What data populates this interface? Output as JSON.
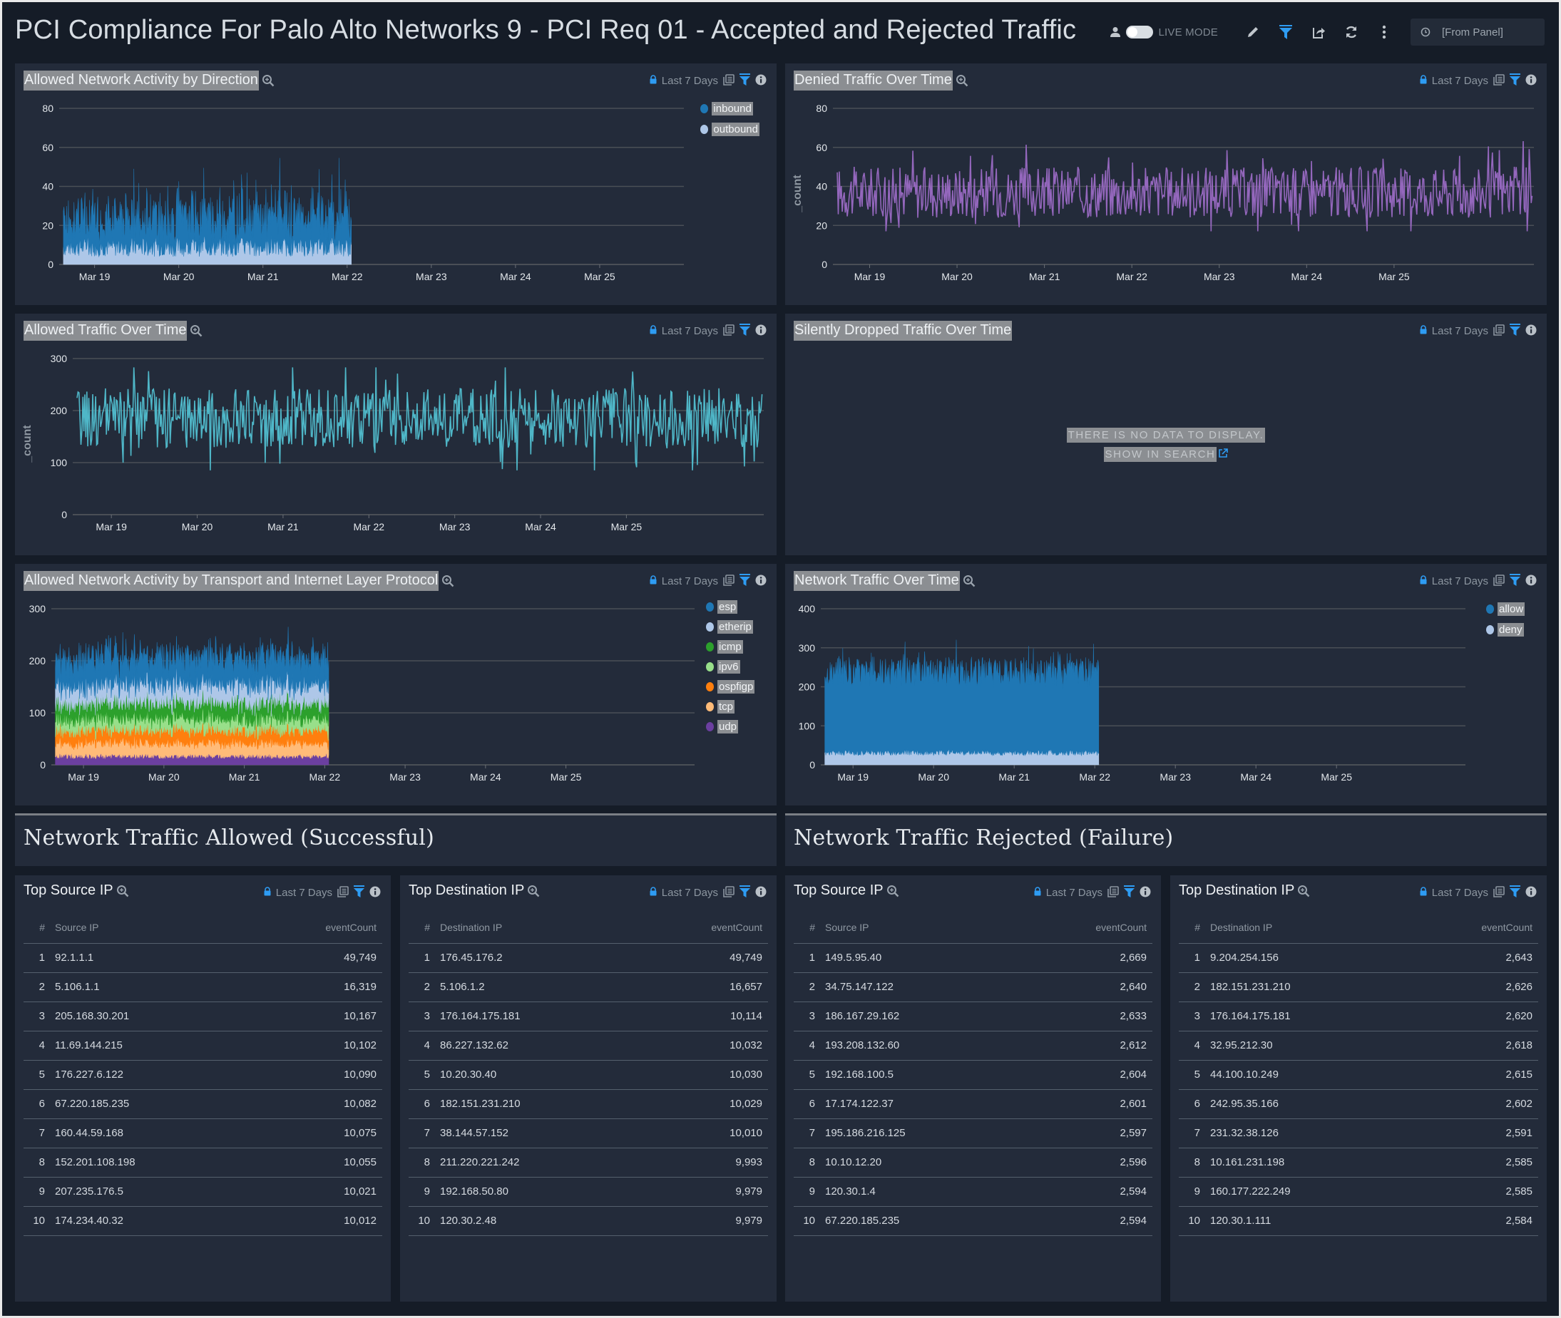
{
  "header": {
    "title": "PCI Compliance For Palo Alto Networks 9 - PCI Req 01 - Accepted and Rejected Traffic",
    "live_mode_label": "LIVE MODE",
    "time_range": "[From Panel]"
  },
  "time_badge": "Last 7 Days",
  "panels": {
    "direction": {
      "title": "Allowed Network Activity by Direction",
      "legend": [
        "inbound",
        "outbound"
      ]
    },
    "denied": {
      "title": "Denied Traffic Over Time"
    },
    "allowed": {
      "title": "Allowed Traffic Over Time"
    },
    "dropped": {
      "title": "Silently Dropped Traffic Over Time",
      "no_data": "THERE IS NO DATA TO DISPLAY.",
      "show_search": "SHOW IN SEARCH"
    },
    "protocol": {
      "title": "Allowed Network Activity by Transport and Internet Layer Protocol",
      "legend": [
        "esp",
        "etherip",
        "icmp",
        "ipv6",
        "ospfigp",
        "tcp",
        "udp"
      ]
    },
    "network": {
      "title": "Network Traffic Over Time",
      "legend": [
        "allow",
        "deny"
      ]
    }
  },
  "sections": {
    "allowed": "Network Traffic Allowed (Successful)",
    "rejected": "Network Traffic Rejected (Failure)"
  },
  "tables": [
    {
      "title": "Top Source IP",
      "col_num": "#",
      "col_ip": "Source IP",
      "col_count": "eventCount",
      "rows": [
        [
          "1",
          "92.1.1.1",
          "49,749"
        ],
        [
          "2",
          "5.106.1.1",
          "16,319"
        ],
        [
          "3",
          "205.168.30.201",
          "10,167"
        ],
        [
          "4",
          "11.69.144.215",
          "10,102"
        ],
        [
          "5",
          "176.227.6.122",
          "10,090"
        ],
        [
          "6",
          "67.220.185.235",
          "10,082"
        ],
        [
          "7",
          "160.44.59.168",
          "10,075"
        ],
        [
          "8",
          "152.201.108.198",
          "10,055"
        ],
        [
          "9",
          "207.235.176.5",
          "10,021"
        ],
        [
          "10",
          "174.234.40.32",
          "10,012"
        ]
      ]
    },
    {
      "title": "Top Destination IP",
      "col_num": "#",
      "col_ip": "Destination IP",
      "col_count": "eventCount",
      "rows": [
        [
          "1",
          "176.45.176.2",
          "49,749"
        ],
        [
          "2",
          "5.106.1.2",
          "16,657"
        ],
        [
          "3",
          "176.164.175.181",
          "10,114"
        ],
        [
          "4",
          "86.227.132.62",
          "10,032"
        ],
        [
          "5",
          "10.20.30.40",
          "10,030"
        ],
        [
          "6",
          "182.151.231.210",
          "10,029"
        ],
        [
          "7",
          "38.144.57.152",
          "10,010"
        ],
        [
          "8",
          "211.220.221.242",
          "9,993"
        ],
        [
          "9",
          "192.168.50.80",
          "9,979"
        ],
        [
          "10",
          "120.30.2.48",
          "9,979"
        ]
      ]
    },
    {
      "title": "Top Source IP",
      "col_num": "#",
      "col_ip": "Source IP",
      "col_count": "eventCount",
      "rows": [
        [
          "1",
          "149.5.95.40",
          "2,669"
        ],
        [
          "2",
          "34.75.147.122",
          "2,640"
        ],
        [
          "3",
          "186.167.29.162",
          "2,633"
        ],
        [
          "4",
          "193.208.132.60",
          "2,612"
        ],
        [
          "5",
          "192.168.100.5",
          "2,604"
        ],
        [
          "6",
          "17.174.122.37",
          "2,601"
        ],
        [
          "7",
          "195.186.216.125",
          "2,597"
        ],
        [
          "8",
          "10.10.12.20",
          "2,596"
        ],
        [
          "9",
          "120.30.1.4",
          "2,594"
        ],
        [
          "10",
          "67.220.185.235",
          "2,594"
        ]
      ]
    },
    {
      "title": "Top Destination IP",
      "col_num": "#",
      "col_ip": "Destination IP",
      "col_count": "eventCount",
      "rows": [
        [
          "1",
          "9.204.254.156",
          "2,643"
        ],
        [
          "2",
          "182.151.231.210",
          "2,626"
        ],
        [
          "3",
          "176.164.175.181",
          "2,620"
        ],
        [
          "4",
          "32.95.212.30",
          "2,618"
        ],
        [
          "5",
          "44.100.10.249",
          "2,615"
        ],
        [
          "6",
          "242.95.35.166",
          "2,602"
        ],
        [
          "7",
          "231.32.38.126",
          "2,591"
        ],
        [
          "8",
          "10.161.231.198",
          "2,585"
        ],
        [
          "9",
          "160.177.222.249",
          "2,585"
        ],
        [
          "10",
          "120.30.1.111",
          "2,584"
        ]
      ]
    }
  ],
  "colors": {
    "accent": "#2e9cf3",
    "inbound": "#1f77b4",
    "outbound": "#aec7e8",
    "denied_line": "#9467bd",
    "allowed_line": "#4fb7c8",
    "esp": "#1f77b4",
    "etherip": "#aec7e8",
    "icmp": "#2ca02c",
    "ipv6": "#98df8a",
    "ospfigp": "#ff7f0e",
    "tcp": "#ffbb78",
    "udp": "#6b3fa0",
    "allow": "#1f77b4",
    "deny": "#aec7e8"
  },
  "chart_data": [
    {
      "id": "direction",
      "type": "area",
      "stacked": true,
      "title": "Allowed Network Activity by Direction",
      "xlabel": "",
      "ylabel": "",
      "x_ticks": [
        "Mar 19",
        "Mar 20",
        "Mar 21",
        "Mar 22",
        "Mar 23",
        "Mar 24",
        "Mar 25"
      ],
      "x_range_days": [
        -0.42,
        7.0
      ],
      "data_end_day": 3.05,
      "ylim": [
        0,
        80
      ],
      "y_ticks": [
        0,
        20,
        40,
        60,
        80
      ],
      "legend_position": "top-right",
      "series": [
        {
          "name": "inbound",
          "typical_range": [
            10,
            40
          ],
          "max": 61
        },
        {
          "name": "outbound",
          "typical_range": [
            3,
            15
          ],
          "max": 18
        }
      ]
    },
    {
      "id": "denied",
      "type": "line",
      "title": "Denied Traffic Over Time",
      "xlabel": "",
      "ylabel": "_count",
      "x_ticks": [
        "Mar 19",
        "Mar 20",
        "Mar 21",
        "Mar 22",
        "Mar 23",
        "Mar 24",
        "Mar 25"
      ],
      "x_range_days": [
        -0.42,
        7.6
      ],
      "data_end_day": 7.6,
      "ylim": [
        0,
        80
      ],
      "y_ticks": [
        0,
        20,
        40,
        60,
        80
      ],
      "series": [
        {
          "name": "_count",
          "typical_range": [
            25,
            50
          ],
          "min": 17,
          "max": 68,
          "mean": 37
        }
      ]
    },
    {
      "id": "allowed",
      "type": "line",
      "title": "Allowed Traffic Over Time",
      "xlabel": "",
      "ylabel": "_count",
      "x_ticks": [
        "Mar 19",
        "Mar 20",
        "Mar 21",
        "Mar 22",
        "Mar 23",
        "Mar 24",
        "Mar 25"
      ],
      "x_range_days": [
        -0.45,
        7.6
      ],
      "data_end_day": 7.6,
      "ylim": [
        0,
        300
      ],
      "y_ticks": [
        0,
        100,
        200,
        300
      ],
      "series": [
        {
          "name": "_count",
          "typical_range": [
            130,
            240
          ],
          "min": 85,
          "max": 283,
          "mean": 185
        }
      ]
    },
    {
      "id": "protocol",
      "type": "area",
      "stacked": true,
      "title": "Allowed Network Activity by Transport and Internet Layer Protocol",
      "x_ticks": [
        "Mar 19",
        "Mar 20",
        "Mar 21",
        "Mar 22",
        "Mar 23",
        "Mar 24",
        "Mar 25"
      ],
      "x_range_days": [
        -0.4,
        7.6
      ],
      "data_end_day": 3.05,
      "ylim": [
        0,
        300
      ],
      "y_ticks": [
        0,
        100,
        200,
        300
      ],
      "legend_position": "top-right",
      "series": [
        {
          "name": "udp",
          "mean": 17
        },
        {
          "name": "tcp",
          "mean": 25
        },
        {
          "name": "ospfigp",
          "mean": 25
        },
        {
          "name": "ipv6",
          "mean": 25
        },
        {
          "name": "icmp",
          "mean": 30
        },
        {
          "name": "etherip",
          "mean": 35
        },
        {
          "name": "esp",
          "mean": 55
        }
      ]
    },
    {
      "id": "network",
      "type": "area",
      "stacked": true,
      "title": "Network Traffic Over Time",
      "x_ticks": [
        "Mar 19",
        "Mar 20",
        "Mar 21",
        "Mar 22",
        "Mar 23",
        "Mar 24",
        "Mar 25"
      ],
      "x_range_days": [
        -0.4,
        7.6
      ],
      "data_end_day": 3.05,
      "ylim": [
        0,
        400
      ],
      "y_ticks": [
        0,
        100,
        200,
        300,
        400
      ],
      "legend_position": "top-right",
      "series": [
        {
          "name": "allow",
          "typical_range": [
            180,
            290
          ],
          "max": 345
        },
        {
          "name": "deny",
          "typical_range": [
            22,
            40
          ],
          "max": 45
        }
      ]
    },
    {
      "id": "dropped",
      "type": "line",
      "title": "Silently Dropped Traffic Over Time",
      "series": []
    }
  ]
}
